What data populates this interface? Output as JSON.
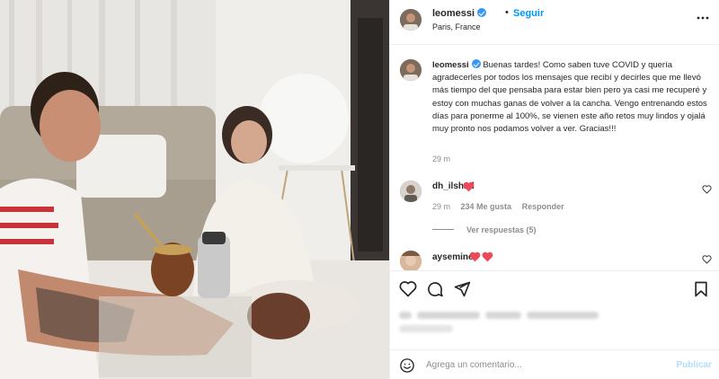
{
  "post": {
    "author": {
      "username": "leomessi",
      "verified": true,
      "follow_label": "Seguir",
      "separator": "•",
      "location": "Paris, France",
      "avatar_icon": "profile-avatar"
    },
    "caption": {
      "username": "leomessi",
      "text": "Buenas tardes! Como saben tuve COVID y quería agradecerles por todos los mensajes que recibí y decirles que me llevó más tiempo del que pensaba para estar bien pero ya casi me recuperé y estoy con muchas ganas de volver a la cancha. Vengo entrenando estos días para ponerme al 100%, se vienen este año retos muy lindos y ojalá muy pronto nos podamos volver a ver. Gracias!!!",
      "time": "29 m"
    },
    "comments": [
      {
        "username": "dh_ilshad",
        "emoji": "heart",
        "time": "29 m",
        "likes": "234 Me gusta",
        "reply_label": "Responder",
        "view_replies": "Ver respuestas (5)"
      },
      {
        "username": "aysemineb",
        "emoji": "two-hearts"
      }
    ],
    "actions": {
      "icons": [
        "heart-icon",
        "comment-icon",
        "share-icon",
        "bookmark-icon"
      ]
    },
    "add_comment": {
      "placeholder": "Agrega un comentario...",
      "publish_label": "Publicar",
      "emoji_icon": "smiley-icon"
    }
  },
  "colors": {
    "link_blue": "#0095f6",
    "verified_blue": "#3897f0",
    "heart_red": "#ed4956",
    "muted_text": "#8e8e8e",
    "publish_disabled": "#b2dffc",
    "border": "#efefef"
  }
}
